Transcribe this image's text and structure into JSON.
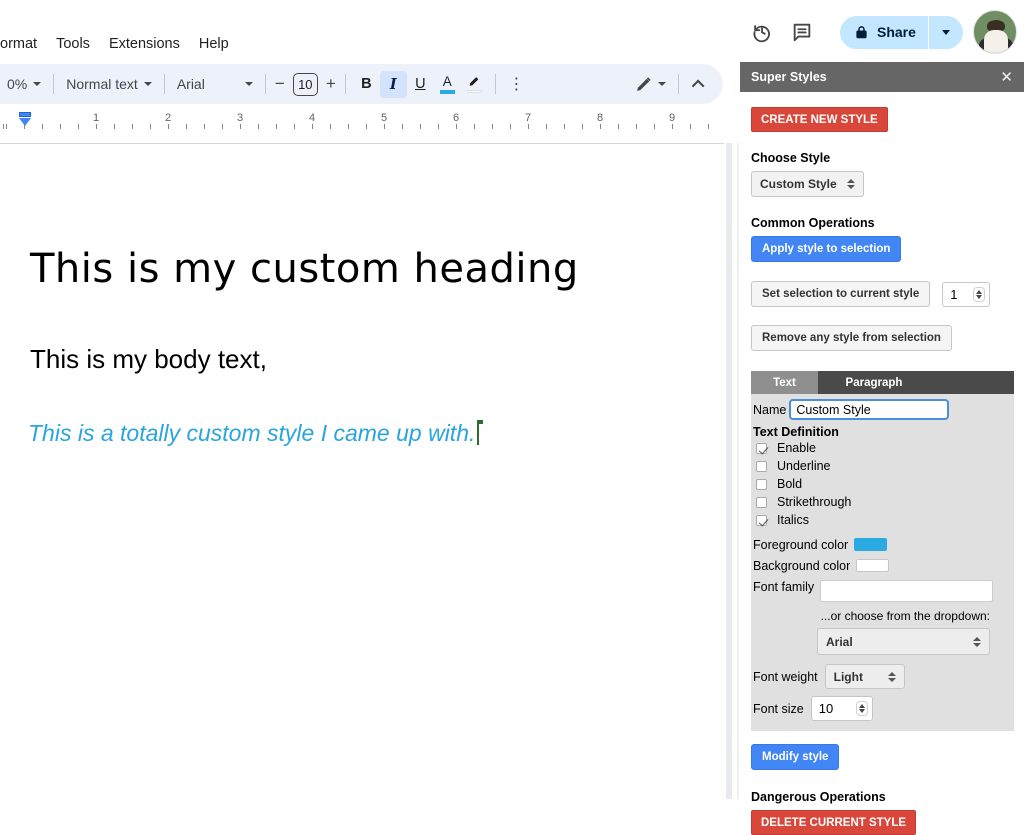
{
  "menu": {
    "items": [
      "ormat",
      "Tools",
      "Extensions",
      "Help"
    ]
  },
  "top_actions": {
    "share_label": "Share"
  },
  "toolbar": {
    "zoom_value": "0%",
    "styles_value": "Normal text",
    "font_value": "Arial",
    "font_size_value": "10",
    "minus": "−",
    "plus": "+",
    "bold": "B",
    "italic": "I",
    "underline": "U",
    "text_color": "A",
    "more": "⋮",
    "accent_underline_color": "#29ABE2"
  },
  "ruler": {
    "numbers": [
      "1",
      "2",
      "3",
      "4",
      "5",
      "6",
      "7",
      "8",
      "9"
    ]
  },
  "document": {
    "heading": "This is my custom heading",
    "body": "This is my body text,",
    "custom": "This is a totally custom style I came up with.",
    "custom_color": "#29A4DC",
    "caret_color": "#2F6B2F"
  },
  "sidebar": {
    "title": "Super Styles",
    "close": "✕",
    "create_button": "CREATE NEW STYLE",
    "choose_style_label": "Choose Style",
    "style_select_value": "Custom Style",
    "common_ops_label": "Common Operations",
    "apply_button": "Apply style to selection",
    "set_selection_button": "Set selection to current style",
    "set_selection_value": "1",
    "remove_button": "Remove any style from selection",
    "tabs": [
      {
        "label": "Text",
        "active": true
      },
      {
        "label": "Paragraph",
        "active": false
      }
    ],
    "name_label": "Name",
    "name_value": "Custom Style",
    "text_definition_label": "Text Definition",
    "checkboxes": [
      {
        "label": "Enable",
        "checked": true
      },
      {
        "label": "Underline",
        "checked": false
      },
      {
        "label": "Bold",
        "checked": false
      },
      {
        "label": "Strikethrough",
        "checked": false
      },
      {
        "label": "Italics",
        "checked": true
      }
    ],
    "foreground_label": "Foreground color",
    "foreground_color": "#29ABE2",
    "background_label": "Background color",
    "background_color": "#FFFFFF",
    "font_family_label": "Font family",
    "dropdown_hint": "...or choose from the dropdown:",
    "font_dropdown_value": "Arial",
    "font_weight_label": "Font weight",
    "font_weight_value": "Light",
    "font_size_label": "Font size",
    "font_size_value": "10",
    "modify_button": "Modify style",
    "dangerous_label": "Dangerous Operations",
    "delete_button": "DELETE CURRENT STYLE",
    "colors": {
      "red": "#D8473A",
      "blue": "#4285F4",
      "header_gray": "#666666"
    }
  }
}
